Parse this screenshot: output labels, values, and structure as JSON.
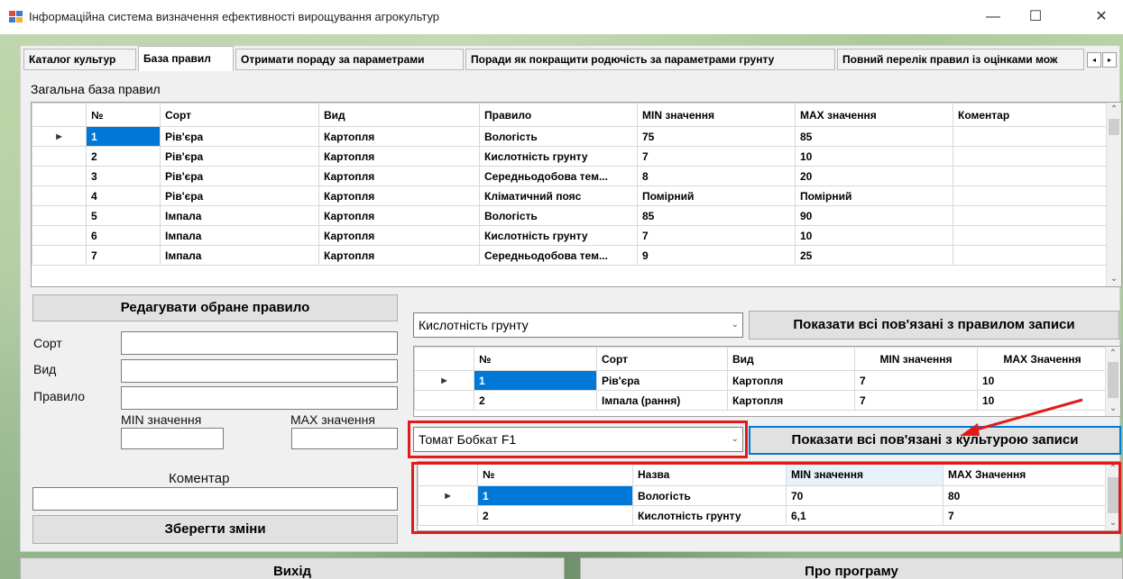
{
  "window": {
    "title": "Інформаційна система визначення ефективності вирощування агрокультур",
    "minimize": "—",
    "maximize": "☐",
    "close": "✕"
  },
  "tabs": [
    "Каталог культур",
    "База правил",
    "Отримати пораду за параметрами",
    "Поради як покращити родючість за параметрами грунту",
    "Повний перелік правил із оцінками мож"
  ],
  "tab_scroll": {
    "left": "◂",
    "right": "▸"
  },
  "rules_section": {
    "label": "Загальна база правил",
    "columns": [
      "№",
      "Сорт",
      "Вид",
      "Правило",
      "MIN значення",
      "MAX значення",
      "Коментар"
    ],
    "rows": [
      [
        "1",
        "Рів'єра",
        "Картопля",
        "Вологість",
        "75",
        "85",
        ""
      ],
      [
        "2",
        "Рів'єра",
        "Картопля",
        "Кислотність грунту",
        "7",
        "10",
        ""
      ],
      [
        "3",
        "Рів'єра",
        "Картопля",
        "Середньодобова тем...",
        "8",
        "20",
        ""
      ],
      [
        "4",
        "Рів'єра",
        "Картопля",
        "Кліматичний пояс",
        "Помірний",
        "Помірний",
        ""
      ],
      [
        "5",
        "Імпала",
        "Картопля",
        "Вологість",
        "85",
        "90",
        ""
      ],
      [
        "6",
        "Імпала",
        "Картопля",
        "Кислотність грунту",
        "7",
        "10",
        ""
      ],
      [
        "7",
        "Імпала",
        "Картопля",
        "Середньодобова тем...",
        "9",
        "25",
        ""
      ]
    ]
  },
  "edit_form": {
    "edit_button": "Редагувати обране правило",
    "sort_label": "Сорт",
    "kind_label": "Вид",
    "rule_label": "Правило",
    "min_label": "MIN значення",
    "max_label": "MAX значення",
    "comment_label": "Коментар",
    "save_button": "Зберегти зміни",
    "sort_value": "",
    "kind_value": "",
    "rule_value": "",
    "min_value": "",
    "max_value": "",
    "comment_value": ""
  },
  "rule_filter": {
    "selected": "Кислотність грунту",
    "button": "Показати всі пов'язані з правилом записи",
    "columns": [
      "№",
      "Сорт",
      "Вид",
      "MIN значення",
      "MAX Значення"
    ],
    "rows": [
      [
        "1",
        "Рів'єра",
        "Картопля",
        "7",
        "10"
      ],
      [
        "2",
        "Імпала (рання)",
        "Картопля",
        "7",
        "10"
      ]
    ]
  },
  "crop_filter": {
    "selected": "Томат Бобкат F1",
    "button": "Показати всі пов'язані з культурою записи",
    "columns": [
      "№",
      "Назва",
      "MIN значення",
      "MAX Значення"
    ],
    "rows": [
      [
        "1",
        "Вологість",
        "70",
        "80"
      ],
      [
        "2",
        "Кислотність грунту",
        "6,1",
        "7"
      ]
    ]
  },
  "bottom": {
    "exit_button": "Вихід",
    "about_button": "Про програму"
  },
  "colors": {
    "selection": "#0078d7",
    "highlight": "#e11a1a",
    "focused_button_border": "#0078d7"
  },
  "icons": {
    "row_pointer": "▶",
    "dropdown": "chevron-down-icon",
    "arrow": "red-arrow-annotation"
  }
}
